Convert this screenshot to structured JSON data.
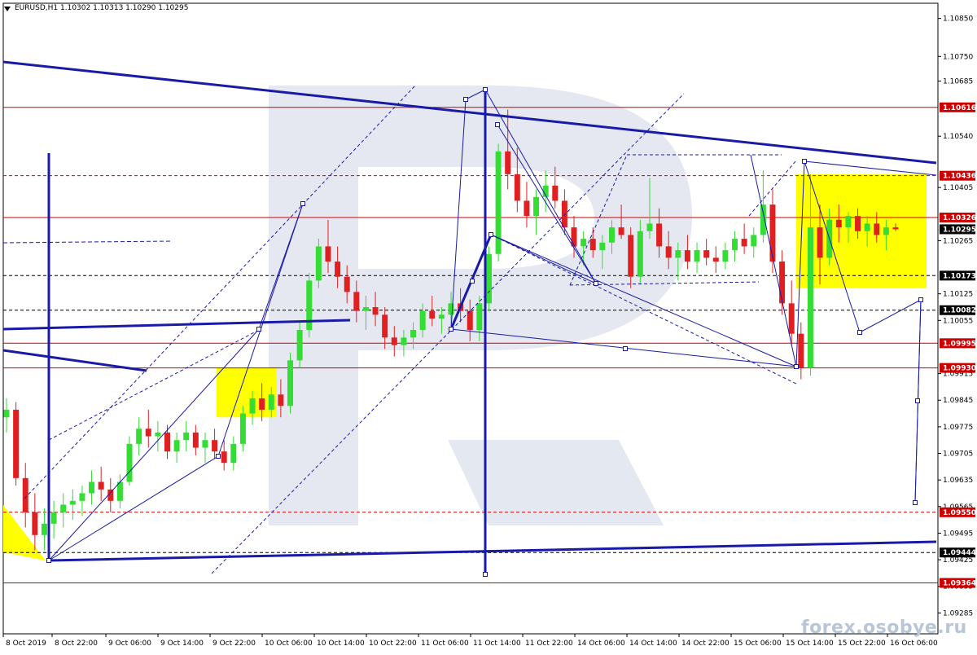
{
  "header": {
    "symbol": "EURUSD,H1",
    "ohlc": "1.10302 1.10313 1.10290 1.10295"
  },
  "watermark": "forex.osobye.ru",
  "colors": {
    "bull": "#33dd33",
    "bear": "#e02020",
    "trend": "#1a1aa8",
    "level": "#cc0000",
    "zone": "#ffff00",
    "watermark": "#cfd6e4"
  },
  "chart_data": {
    "type": "candlestick",
    "symbol": "EURUSD",
    "timeframe": "H1",
    "ylim": [
      1.0923,
      1.1089
    ],
    "y_ticks": [
      "1.10850",
      "1.10750",
      "1.10685",
      "1.10540",
      "1.10405",
      "1.10265",
      "1.10125",
      "1.10055",
      "1.09915",
      "1.09845",
      "1.09775",
      "1.09705",
      "1.09635",
      "1.09565",
      "1.09495",
      "1.09425",
      "1.09355",
      "1.09285"
    ],
    "x_tick_labels": [
      "8 Oct 2019",
      "8 Oct 22:00",
      "9 Oct 06:00",
      "9 Oct 14:00",
      "9 Oct 22:00",
      "10 Oct 06:00",
      "10 Oct 14:00",
      "10 Oct 22:00",
      "11 Oct 06:00",
      "11 Oct 14:00",
      "11 Oct 22:00",
      "14 Oct 06:00",
      "14 Oct 14:00",
      "14 Oct 22:00",
      "15 Oct 06:00",
      "15 Oct 14:00",
      "15 Oct 22:00",
      "16 Oct 06:00"
    ],
    "price_levels": [
      {
        "label": "1.10616",
        "style": "solid",
        "color": "red"
      },
      {
        "label": "1.10436",
        "style": "dashed",
        "color": "red"
      },
      {
        "label": "1.10326",
        "style": "solid",
        "color": "red"
      },
      {
        "label": "1.10295",
        "style": "current",
        "color": "black"
      },
      {
        "label": "1.10173",
        "style": "dashed",
        "color": "black"
      },
      {
        "label": "1.10082",
        "style": "dashed",
        "color": "black"
      },
      {
        "label": "1.09995",
        "style": "solid",
        "color": "red"
      },
      {
        "label": "1.09930",
        "style": "solid",
        "color": "red"
      },
      {
        "label": "1.09550",
        "style": "dashed",
        "color": "red"
      },
      {
        "label": "1.09444",
        "style": "dashed",
        "color": "black"
      },
      {
        "label": "1.09364",
        "style": "solid",
        "color": "red"
      }
    ],
    "candles_approx": [
      [
        1.098,
        1.0985,
        1.0976,
        1.0982
      ],
      [
        1.0982,
        1.0984,
        1.0962,
        1.0964
      ],
      [
        1.0964,
        1.0968,
        1.0951,
        1.0955
      ],
      [
        1.0955,
        1.096,
        1.0945,
        1.0949
      ],
      [
        1.0949,
        1.0956,
        1.0945,
        1.0952
      ],
      [
        1.0952,
        1.0958,
        1.0948,
        1.0955
      ],
      [
        1.0955,
        1.096,
        1.0951,
        1.0957
      ],
      [
        1.0957,
        1.0961,
        1.0953,
        1.0958
      ],
      [
        1.0958,
        1.0962,
        1.0954,
        1.096
      ],
      [
        1.096,
        1.0966,
        1.0957,
        1.0963
      ],
      [
        1.0963,
        1.0967,
        1.0958,
        1.0961
      ],
      [
        1.0961,
        1.0964,
        1.0955,
        1.0958
      ],
      [
        1.0958,
        1.0965,
        1.0956,
        1.0963
      ],
      [
        1.0963,
        1.0975,
        1.0962,
        1.0973
      ],
      [
        1.0973,
        1.098,
        1.097,
        1.0977
      ],
      [
        1.0977,
        1.0982,
        1.0972,
        1.0975
      ],
      [
        1.0975,
        1.0979,
        1.0971,
        1.0976
      ],
      [
        1.0976,
        1.0978,
        1.0969,
        1.0971
      ],
      [
        1.0971,
        1.0976,
        1.0968,
        1.0974
      ],
      [
        1.0974,
        1.0979,
        1.0971,
        1.0976
      ],
      [
        1.0976,
        1.0978,
        1.097,
        1.0972
      ],
      [
        1.0972,
        1.0976,
        1.0968,
        1.0974
      ],
      [
        1.0974,
        1.0977,
        1.0969,
        1.0971
      ],
      [
        1.0971,
        1.0974,
        1.0966,
        1.0968
      ],
      [
        1.0968,
        1.0975,
        1.0966,
        1.0973
      ],
      [
        1.0973,
        1.0983,
        1.0971,
        1.0981
      ],
      [
        1.0981,
        1.0987,
        1.0978,
        1.0985
      ],
      [
        1.0985,
        1.0989,
        1.0979,
        1.0982
      ],
      [
        1.0982,
        1.0988,
        1.098,
        1.0986
      ],
      [
        1.0986,
        1.099,
        1.098,
        1.0983
      ],
      [
        1.0983,
        1.0997,
        1.0981,
        1.0995
      ],
      [
        1.0995,
        1.1005,
        1.0993,
        1.1003
      ],
      [
        1.1003,
        1.1018,
        1.1001,
        1.1016
      ],
      [
        1.1016,
        1.1027,
        1.1014,
        1.1025
      ],
      [
        1.1025,
        1.1032,
        1.1018,
        1.1021
      ],
      [
        1.1021,
        1.1025,
        1.1014,
        1.1017
      ],
      [
        1.1017,
        1.102,
        1.101,
        1.1013
      ],
      [
        1.1013,
        1.1016,
        1.1005,
        1.1008
      ],
      [
        1.1008,
        1.1012,
        1.1003,
        1.1009
      ],
      [
        1.1009,
        1.1013,
        1.1004,
        1.1007
      ],
      [
        1.1007,
        1.1009,
        1.0998,
        1.1001
      ],
      [
        1.1001,
        1.1004,
        1.0996,
        1.0999
      ],
      [
        1.0999,
        1.1003,
        1.0996,
        1.1001
      ],
      [
        1.1001,
        1.1005,
        1.0998,
        1.1003
      ],
      [
        1.1003,
        1.101,
        1.1001,
        1.1008
      ],
      [
        1.1008,
        1.1012,
        1.1004,
        1.1006
      ],
      [
        1.1006,
        1.1009,
        1.1002,
        1.1007
      ],
      [
        1.1007,
        1.1013,
        1.1004,
        1.101
      ],
      [
        1.101,
        1.1014,
        1.1005,
        1.1008
      ],
      [
        1.1008,
        1.1011,
        1.1,
        1.1003
      ],
      [
        1.1003,
        1.1012,
        1.1,
        1.101
      ],
      [
        1.101,
        1.1025,
        1.1008,
        1.1023
      ],
      [
        1.1023,
        1.1052,
        1.1021,
        1.105
      ],
      [
        1.105,
        1.1061,
        1.104,
        1.1044
      ],
      [
        1.1044,
        1.1051,
        1.1034,
        1.1037
      ],
      [
        1.1037,
        1.1042,
        1.103,
        1.1033
      ],
      [
        1.1033,
        1.104,
        1.1028,
        1.1038
      ],
      [
        1.1038,
        1.1045,
        1.1034,
        1.1041
      ],
      [
        1.1041,
        1.1046,
        1.1035,
        1.1037
      ],
      [
        1.1037,
        1.104,
        1.1028,
        1.103
      ],
      [
        1.103,
        1.1033,
        1.1022,
        1.1025
      ],
      [
        1.1025,
        1.1029,
        1.102,
        1.1027
      ],
      [
        1.1027,
        1.103,
        1.1022,
        1.1024
      ],
      [
        1.1024,
        1.1028,
        1.1019,
        1.1026
      ],
      [
        1.1026,
        1.1032,
        1.1023,
        1.103
      ],
      [
        1.103,
        1.1036,
        1.1027,
        1.1028
      ],
      [
        1.1028,
        1.103,
        1.1014,
        1.1017
      ],
      [
        1.1017,
        1.1032,
        1.1015,
        1.1029
      ],
      [
        1.1029,
        1.1043,
        1.1027,
        1.1031
      ],
      [
        1.1031,
        1.1035,
        1.1022,
        1.1025
      ],
      [
        1.1025,
        1.1029,
        1.1019,
        1.1022
      ],
      [
        1.1022,
        1.1026,
        1.1016,
        1.1024
      ],
      [
        1.1024,
        1.1028,
        1.1019,
        1.1021
      ],
      [
        1.1021,
        1.1026,
        1.1018,
        1.1024
      ],
      [
        1.1024,
        1.1027,
        1.102,
        1.1022
      ],
      [
        1.1022,
        1.1025,
        1.1018,
        1.1021
      ],
      [
        1.1021,
        1.1026,
        1.1019,
        1.1024
      ],
      [
        1.1024,
        1.1029,
        1.1021,
        1.1027
      ],
      [
        1.1027,
        1.1031,
        1.1023,
        1.1025
      ],
      [
        1.1025,
        1.103,
        1.1022,
        1.1028
      ],
      [
        1.1028,
        1.1045,
        1.1026,
        1.1036
      ],
      [
        1.1036,
        1.104,
        1.1018,
        1.1021
      ],
      [
        1.1021,
        1.1024,
        1.1007,
        1.101
      ],
      [
        1.101,
        1.1016,
        1.0999,
        1.1002
      ],
      [
        1.1002,
        1.1005,
        1.099,
        1.0993
      ],
      [
        1.0993,
        1.1044,
        1.0991,
        1.103
      ],
      [
        1.103,
        1.1036,
        1.1015,
        1.1022
      ],
      [
        1.1022,
        1.1035,
        1.102,
        1.1032
      ],
      [
        1.1032,
        1.1036,
        1.1026,
        1.103
      ],
      [
        1.103,
        1.1034,
        1.1026,
        1.1033
      ],
      [
        1.1033,
        1.1035,
        1.1027,
        1.1029
      ],
      [
        1.1029,
        1.1033,
        1.1025,
        1.1031
      ],
      [
        1.1031,
        1.1034,
        1.1026,
        1.1028
      ],
      [
        1.1028,
        1.1032,
        1.1024,
        1.103
      ],
      [
        1.103,
        1.1031,
        1.1029,
        1.10295
      ]
    ],
    "zones": [
      {
        "from": "9 Oct 22:00",
        "price_range": [
          1.098,
          1.0993
        ]
      },
      {
        "from": "15 Oct 14:00",
        "price_range": [
          1.1014,
          1.1044
        ]
      }
    ]
  }
}
